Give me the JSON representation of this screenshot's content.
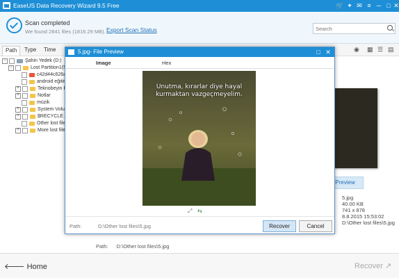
{
  "window": {
    "title": "EaseUS Data Recovery Wizard 9.5 Free",
    "controls": [
      "cart",
      "pin",
      "chat",
      "menu",
      "minimize",
      "maximize",
      "close"
    ]
  },
  "header": {
    "status": "Scan completed",
    "info": "We found 2841 files (1816.29 MB).",
    "export_link": "Export Scan Status",
    "search_placeholder": "Search"
  },
  "tabs": [
    {
      "label": "Path",
      "active": true
    },
    {
      "label": "Type",
      "active": false
    },
    {
      "label": "Time",
      "active": false
    }
  ],
  "tree": [
    {
      "label": "Şahin Yedek (D:)",
      "icon": "drive-icon"
    },
    {
      "label": "Lost Partition1(N",
      "icon": "folder-icon"
    },
    {
      "label": "c42d44c626a8",
      "icon": "folder-red-icon"
    },
    {
      "label": "android eğitin",
      "icon": "folder-icon"
    },
    {
      "label": "Teknobeyin F",
      "icon": "folder-icon"
    },
    {
      "label": "Notlar",
      "icon": "folder-icon"
    },
    {
      "label": "müzik",
      "icon": "folder-icon"
    },
    {
      "label": "System Volur",
      "icon": "folder-icon"
    },
    {
      "label": "$RECYCLE.BII",
      "icon": "folder-icon"
    },
    {
      "label": "Other lost file",
      "icon": "folder-icon"
    },
    {
      "label": "More lost file",
      "icon": "star-folder-icon"
    }
  ],
  "details": {
    "preview_button": "Preview",
    "name": "5.jpg",
    "size": "40.00 KB",
    "dimensions": "741 x 878",
    "date": "8.8.2015 15:53:02",
    "path": "D:\\Other lost files\\5.jpg"
  },
  "path_strip": {
    "label": "Path:",
    "value": "D:\\Other lost files\\5.jpg"
  },
  "footer": {
    "home": "Home",
    "recover": "Recover"
  },
  "dialog": {
    "title": "5.jpg- File Preview",
    "tabs": [
      "Image",
      "Hex"
    ],
    "caption": "Unutma, kırarlar diye hayal kurmaktan vazgeçmeyelim.",
    "path_label": "Path:",
    "path": "D:\\Other lost files\\5.jpg",
    "recover_button": "Recover",
    "cancel_button": "Cancel"
  },
  "colors": {
    "accent": "#1e8fd6",
    "link": "#1e6fb6"
  }
}
